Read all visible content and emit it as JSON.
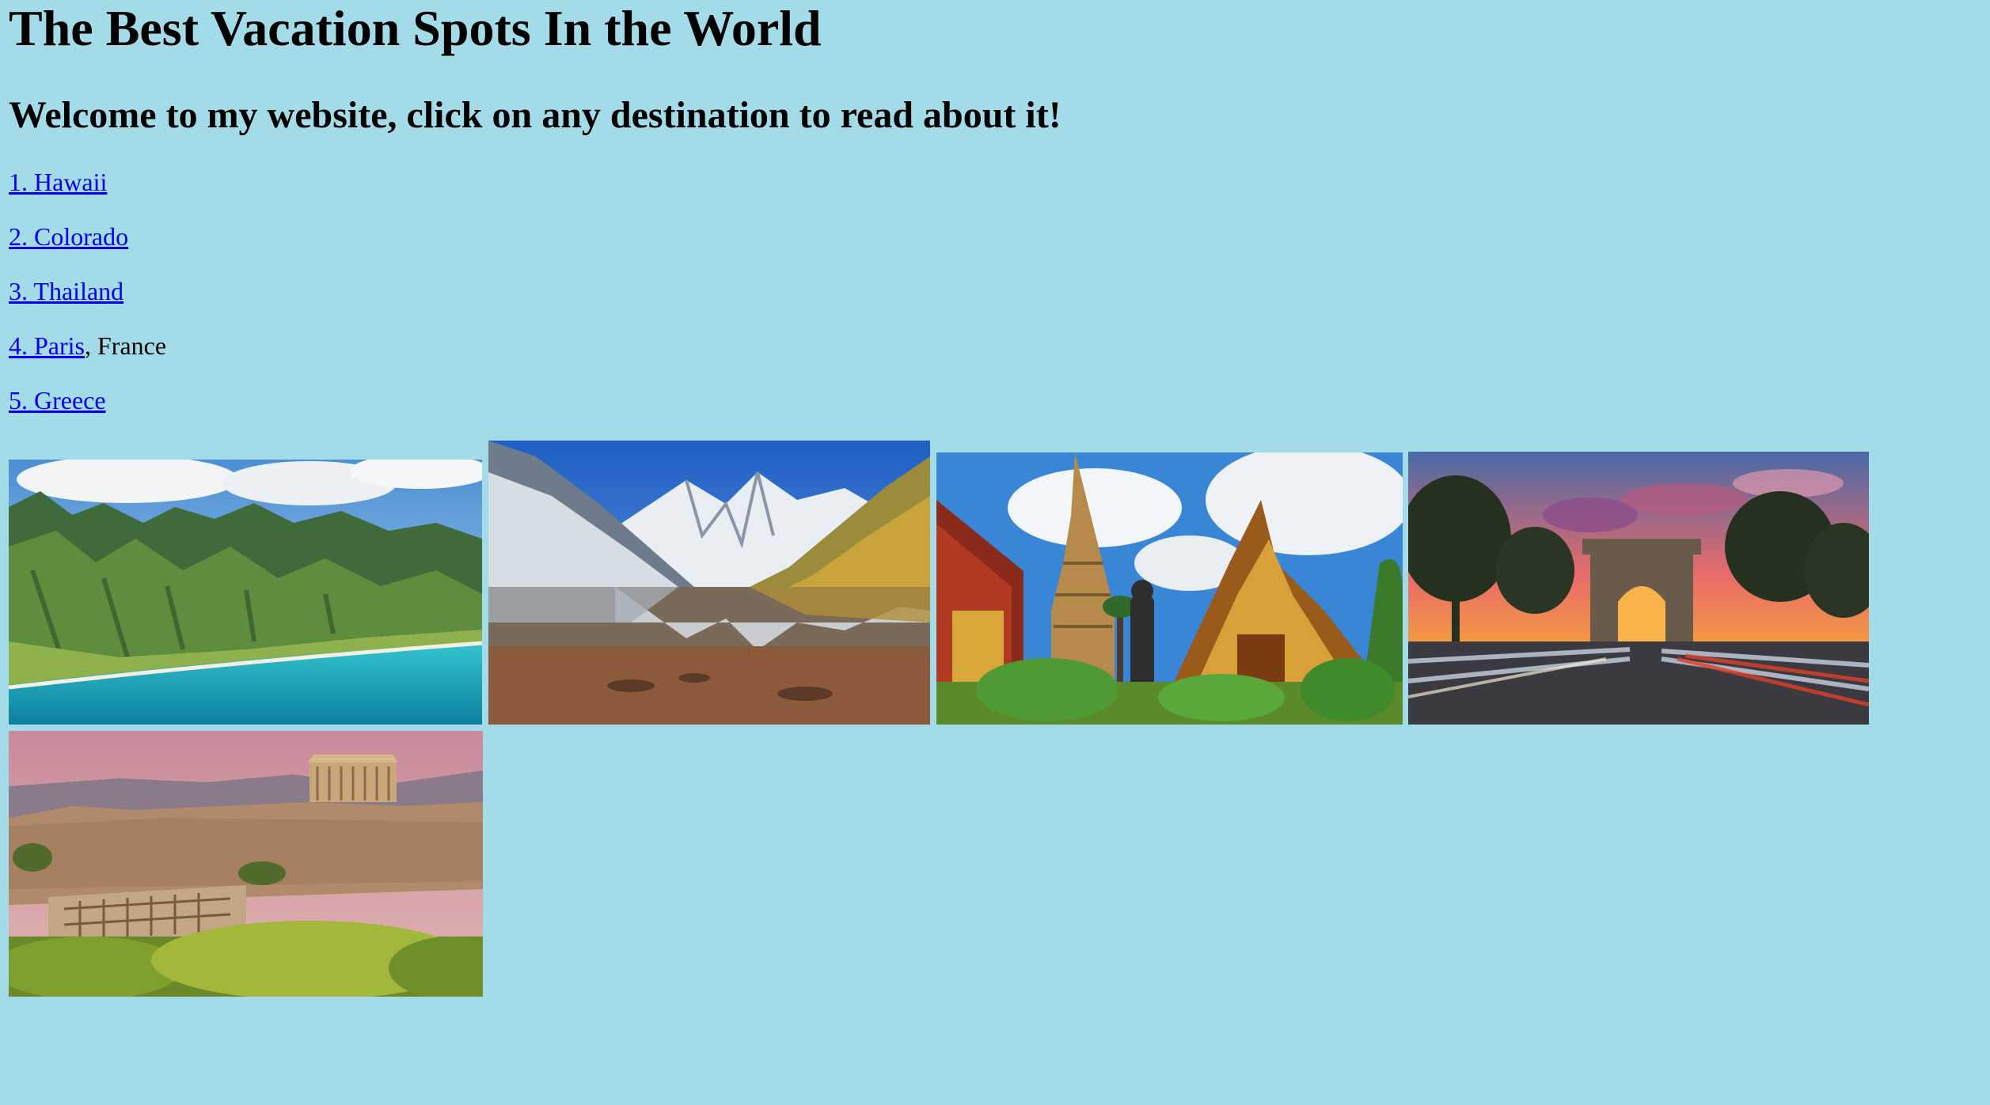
{
  "page": {
    "title": "The Best Vacation Spots In the World",
    "subtitle": "Welcome to my website, click on any destination to read about it!"
  },
  "destinations": [
    {
      "link_text": "1. Hawaii",
      "suffix": ""
    },
    {
      "link_text": "2. Colorado",
      "suffix": ""
    },
    {
      "link_text": "3. Thailand",
      "suffix": ""
    },
    {
      "link_text": "4. Paris",
      "suffix": ", France"
    },
    {
      "link_text": "5. Greece",
      "suffix": ""
    }
  ],
  "images": [
    {
      "subject": "hawaii-coastline"
    },
    {
      "subject": "colorado-maroon-bells"
    },
    {
      "subject": "thailand-temple"
    },
    {
      "subject": "paris-arc-de-triomphe"
    },
    {
      "subject": "greece-acropolis"
    }
  ],
  "colors": {
    "background": "#a4dbe8",
    "link": "#0000ee",
    "text": "#000000"
  }
}
